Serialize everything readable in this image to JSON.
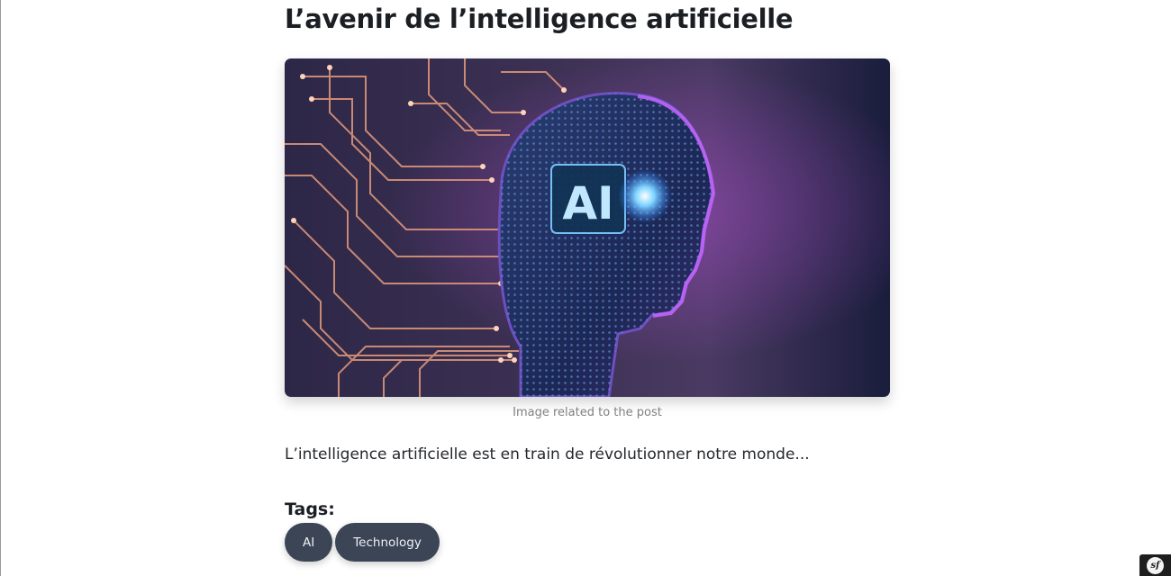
{
  "post": {
    "title": "L’avenir de l’intelligence artificielle",
    "image": {
      "alt": "Image related to the post",
      "caption": "Image related to the post",
      "badge_text": "AI"
    },
    "excerpt": "L’intelligence artificielle est en train de révolutionner notre monde...",
    "tags_heading": "Tags:",
    "tags": [
      {
        "label": "AI"
      },
      {
        "label": "Technology"
      }
    ]
  },
  "debug_toolbar": {
    "logo_text": "sf",
    "icon": "symfony-icon"
  },
  "colors": {
    "tag_background": "#3b4556",
    "tag_text": "#eef0f4",
    "image_bg_dark": "#1a1d3c",
    "circuit": "#e49a7c",
    "head_glow": "#5db8ff"
  }
}
